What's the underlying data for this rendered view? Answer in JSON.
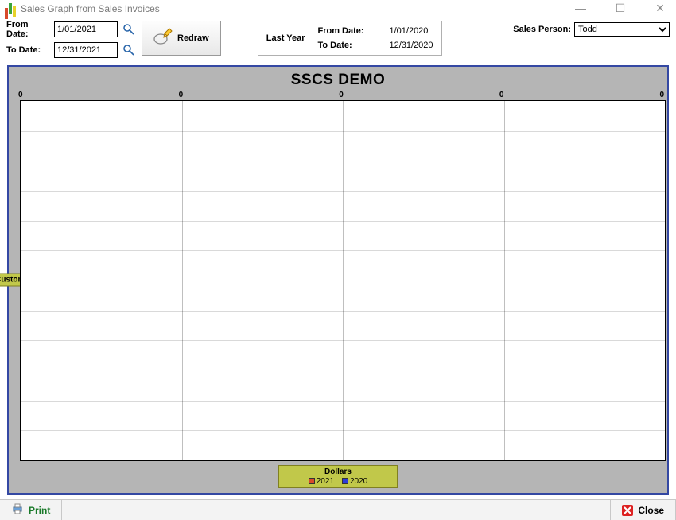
{
  "window": {
    "title": "Sales Graph from Sales Invoices"
  },
  "toolbar": {
    "from_label": "From Date:",
    "to_label": "To Date:",
    "from_value": "1/01/2021",
    "to_value": "12/31/2021",
    "redraw_label": "Redraw",
    "last_year_label": "Last Year",
    "ly_from_label": "From Date:",
    "ly_to_label": "To Date:",
    "ly_from_value": "1/01/2020",
    "ly_to_value": "12/31/2020",
    "sales_person_label": "Sales Person:",
    "sales_person_value": "Todd"
  },
  "chart": {
    "title": "SSCS DEMO",
    "x_ticks": [
      "0",
      "0",
      "0",
      "0",
      "0"
    ],
    "y_axis_label": "Customer",
    "x_axis_label": "Dollars",
    "legend": [
      {
        "label": "2021",
        "color": "#d84a2b"
      },
      {
        "label": "2020",
        "color": "#2b3bd8"
      }
    ]
  },
  "footer": {
    "print_label": "Print",
    "close_label": "Close"
  },
  "chart_data": {
    "type": "bar",
    "orientation": "horizontal",
    "title": "SSCS DEMO",
    "xlabel": "Dollars",
    "ylabel": "Customer",
    "categories": [],
    "series": [
      {
        "name": "2021",
        "values": []
      },
      {
        "name": "2020",
        "values": []
      }
    ],
    "xlim": [
      0,
      0
    ],
    "x_ticks": [
      0,
      0,
      0,
      0,
      0
    ]
  }
}
